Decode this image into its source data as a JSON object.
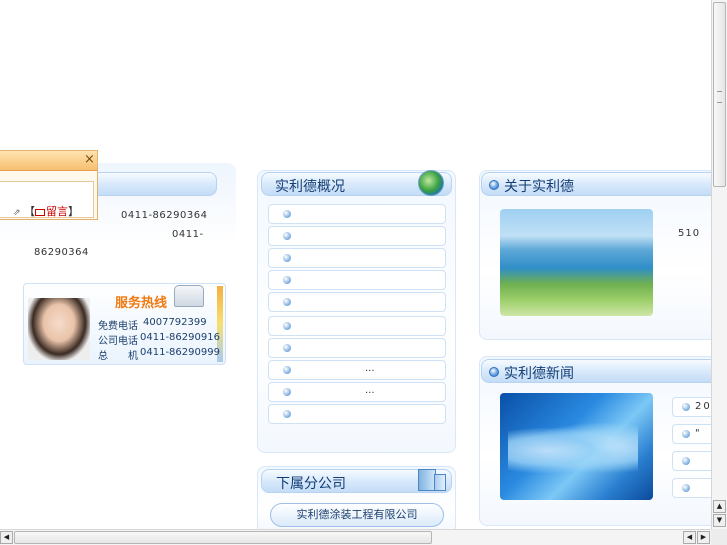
{
  "page_title": "",
  "popup": {
    "close": "×",
    "link_label": "留言",
    "link_bracket_open": "【",
    "link_bracket_close": "】"
  },
  "contact": {
    "phone1": "0411-86290364",
    "phone2_prefix": "0411-",
    "phone2_suffix": "86290364"
  },
  "hotline": {
    "title": "服务热线",
    "lines": [
      {
        "label": "免费电话",
        "value": "4007792399"
      },
      {
        "label": "公司电话",
        "value": "0411-86290916"
      },
      {
        "label": "总　　机",
        "value": "0411-86290999"
      }
    ]
  },
  "overview": {
    "title": "实利德概况",
    "items": [
      {
        "text": ""
      },
      {
        "text": ""
      },
      {
        "text": ""
      },
      {
        "text": ""
      },
      {
        "text": ""
      },
      {
        "text": ""
      },
      {
        "text": ""
      },
      {
        "text": "..."
      },
      {
        "text": "..."
      },
      {
        "text": ""
      }
    ]
  },
  "subsidiary": {
    "title": "下属分公司",
    "button": "实利德涂装工程有限公司"
  },
  "about": {
    "title": "关于实利德",
    "text": "510"
  },
  "news": {
    "title": "实利德新闻",
    "items": [
      {
        "text": "20"
      },
      {
        "text": "\""
      },
      {
        "text": ""
      },
      {
        "text": ""
      }
    ]
  },
  "colors": {
    "title_blue": "#133d75",
    "panel_border": "#d9e7f6",
    "hotline_orange": "#f07a12",
    "link_red": "#cc0000"
  }
}
